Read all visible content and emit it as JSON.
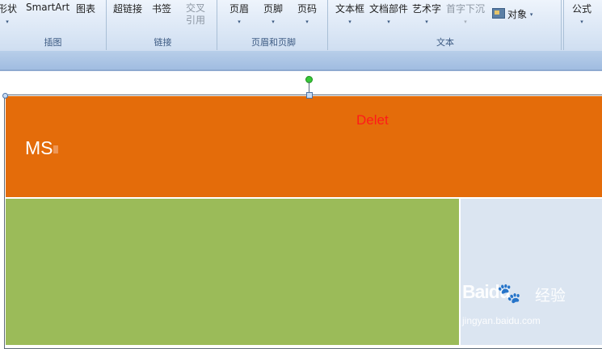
{
  "ribbon": {
    "groups": [
      {
        "title": "插图",
        "buttons": [
          {
            "label": "形状",
            "arrow": "▾"
          },
          {
            "label": "SmartArt"
          },
          {
            "label": "图表"
          }
        ]
      },
      {
        "title": "链接",
        "buttons": [
          {
            "label": "超链接"
          },
          {
            "label": "书签"
          },
          {
            "label_line1": "交叉",
            "label_line2": "引用",
            "disabled": true
          }
        ]
      },
      {
        "title": "页眉和页脚",
        "buttons": [
          {
            "label": "页眉",
            "arrow": "▾"
          },
          {
            "label": "页脚",
            "arrow": "▾"
          },
          {
            "label": "页码",
            "arrow": "▾"
          }
        ]
      },
      {
        "title": "文本",
        "buttons": [
          {
            "label": "文本框",
            "arrow": "▾"
          },
          {
            "label": "文档部件",
            "arrow": "▾"
          },
          {
            "label": "艺术字",
            "arrow": "▾"
          },
          {
            "label": "首字下沉",
            "arrow": "▾",
            "disabled": true
          },
          {
            "label": "对象",
            "arrow": "▾"
          }
        ]
      },
      {
        "title": "",
        "buttons": [
          {
            "label": "公式",
            "arrow": "▾"
          }
        ]
      }
    ]
  },
  "document": {
    "title_text": "MS",
    "red_text": "Delet",
    "colors": {
      "orange": "#e46c0a",
      "green": "#9bbb59",
      "light_blue": "#dbe5f1",
      "red_text": "#ff1a1a"
    }
  },
  "watermark": {
    "logo": "Baidu",
    "paw": "🐾",
    "cn": "经验",
    "url": "jingyan.baidu.com"
  }
}
